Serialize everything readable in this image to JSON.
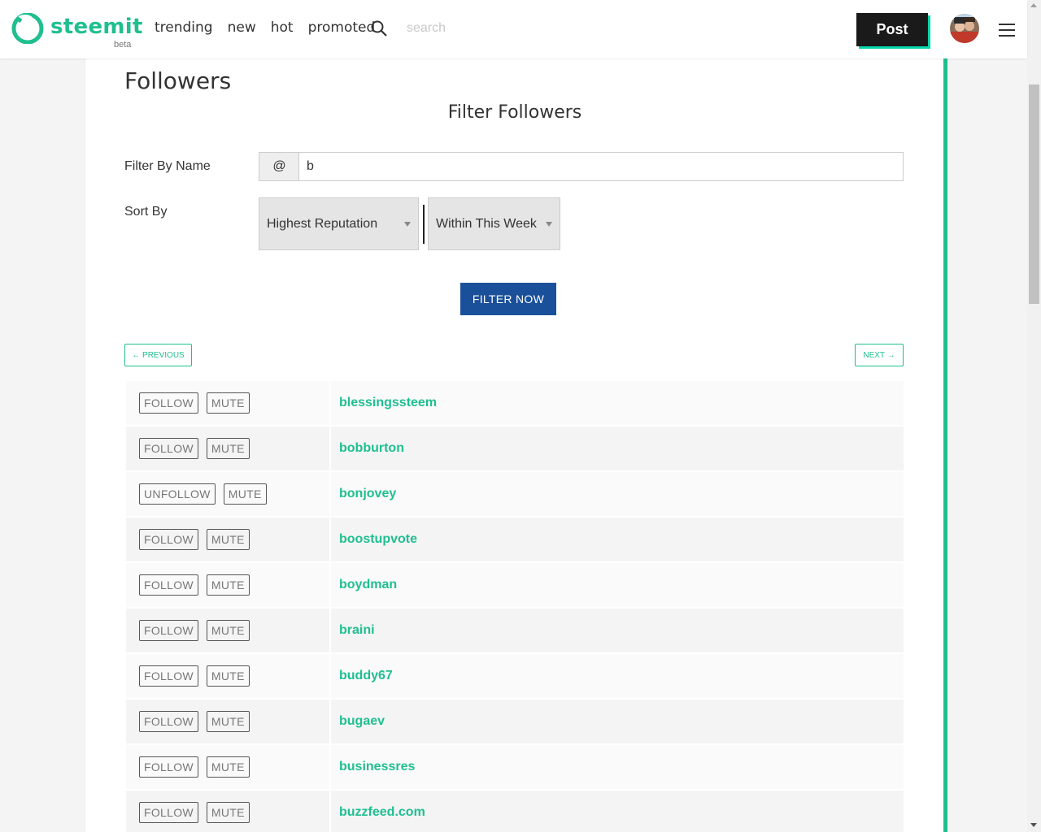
{
  "header": {
    "logo_text": "steemit",
    "logo_badge": "beta",
    "nav": [
      "trending",
      "new",
      "hot",
      "promoted"
    ],
    "search_placeholder": "search",
    "post_label": "Post",
    "brand_color": "#1fbf8f"
  },
  "page": {
    "title": "Followers",
    "filter_title": "Filter Followers",
    "filter_by_name_label": "Filter By Name",
    "at_prefix": "@",
    "name_value": "b",
    "sort_by_label": "Sort By",
    "sort_primary": "Highest Reputation",
    "sort_secondary": "Within This Week",
    "filter_button": "FILTER NOW",
    "previous_label": "← PREVIOUS",
    "next_label": "NEXT →"
  },
  "rows": [
    {
      "follow": "FOLLOW",
      "mute": "MUTE",
      "user": "blessingssteem"
    },
    {
      "follow": "FOLLOW",
      "mute": "MUTE",
      "user": "bobburton"
    },
    {
      "follow": "UNFOLLOW",
      "mute": "MUTE",
      "user": "bonjovey"
    },
    {
      "follow": "FOLLOW",
      "mute": "MUTE",
      "user": "boostupvote"
    },
    {
      "follow": "FOLLOW",
      "mute": "MUTE",
      "user": "boydman"
    },
    {
      "follow": "FOLLOW",
      "mute": "MUTE",
      "user": "braini"
    },
    {
      "follow": "FOLLOW",
      "mute": "MUTE",
      "user": "buddy67"
    },
    {
      "follow": "FOLLOW",
      "mute": "MUTE",
      "user": "bugaev"
    },
    {
      "follow": "FOLLOW",
      "mute": "MUTE",
      "user": "businessres"
    },
    {
      "follow": "FOLLOW",
      "mute": "MUTE",
      "user": "buzzfeed.com"
    }
  ]
}
